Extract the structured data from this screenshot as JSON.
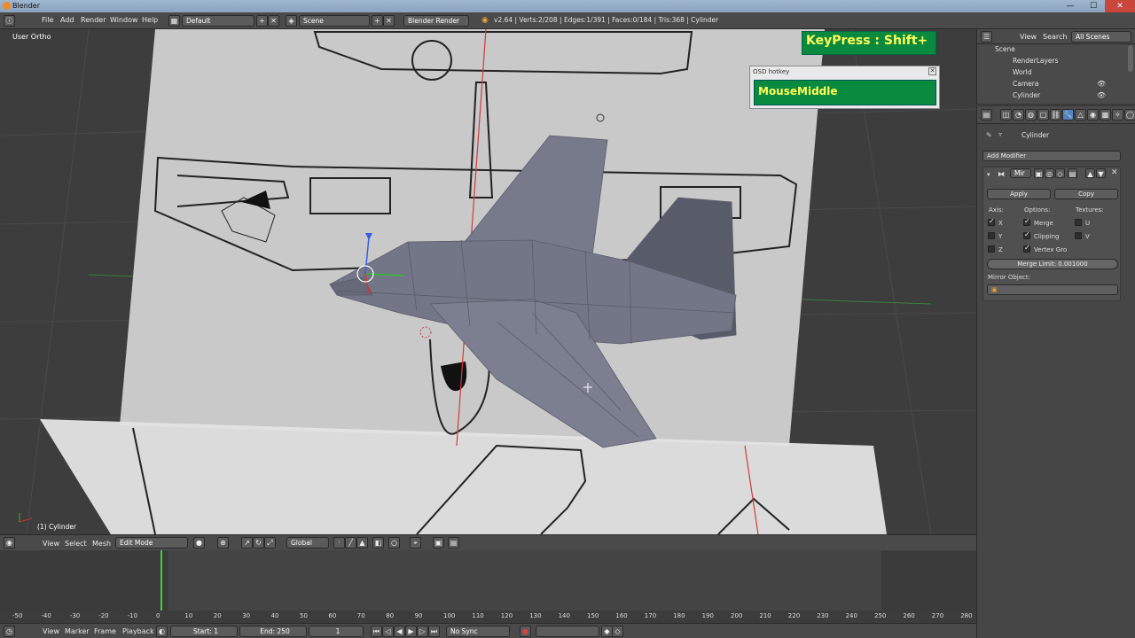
{
  "window": {
    "title": "Blender",
    "min": "—",
    "max": "☐",
    "close": "✕"
  },
  "info_header": {
    "menus": [
      "File",
      "Add",
      "Render",
      "Window",
      "Help"
    ],
    "layout": "Default",
    "scene": "Scene",
    "engine": "Blender Render",
    "stats": "v2.64 | Verts:2/208 | Edges:1/391 | Faces:0/184 | Tris:368 | Cylinder"
  },
  "viewport": {
    "view_label": "User Ortho",
    "object_label": "(1) Cylinder"
  },
  "viewport_header": {
    "menus": [
      "View",
      "Select",
      "Mesh"
    ],
    "mode": "Edit Mode",
    "orientation": "Global"
  },
  "timeline": {
    "ruler": [
      "-50",
      "-40",
      "-30",
      "-20",
      "-10",
      "0",
      "10",
      "20",
      "30",
      "40",
      "50",
      "60",
      "70",
      "80",
      "90",
      "100",
      "110",
      "120",
      "130",
      "140",
      "150",
      "160",
      "170",
      "180",
      "190",
      "200",
      "210",
      "220",
      "230",
      "240",
      "250",
      "260",
      "270",
      "280"
    ],
    "current_frame_value": 0,
    "menus": [
      "View",
      "Marker",
      "Frame",
      "Playback"
    ],
    "start": "Start: 1",
    "end": "End: 250",
    "frame": "1",
    "sync": "No Sync"
  },
  "outliner": {
    "header": {
      "view": "View",
      "search": "Search",
      "filter": "All Scenes"
    },
    "items": [
      "Scene",
      "RenderLayers",
      "World",
      "Camera",
      "Cylinder"
    ]
  },
  "properties": {
    "object_name": "Cylinder",
    "add_modifier": "Add Modifier",
    "modifier_name": "Mir",
    "apply": "Apply",
    "copy": "Copy",
    "axis_label": "Axis:",
    "options_label": "Options:",
    "textures_label": "Textures:",
    "axes": [
      {
        "label": "X",
        "checked": true
      },
      {
        "label": "Y",
        "checked": false
      },
      {
        "label": "Z",
        "checked": false
      }
    ],
    "options": [
      {
        "label": "Merge",
        "checked": true
      },
      {
        "label": "Clipping",
        "checked": true
      },
      {
        "label": "Vertex Gro",
        "checked": true
      }
    ],
    "textures": [
      {
        "label": "U",
        "checked": false
      },
      {
        "label": "V",
        "checked": false
      }
    ],
    "merge_limit": "Merge Limit: 0.001000",
    "mirror_object": "Mirror Object:"
  },
  "osd": {
    "keypress": "KeyPress : Shift+",
    "window_title": "OSD hotkey",
    "mouse": "MouseMiddle"
  },
  "colors": {
    "osd_green": "#0a8a3e",
    "osd_text": "#fffc5a",
    "mesh": "#737686"
  }
}
